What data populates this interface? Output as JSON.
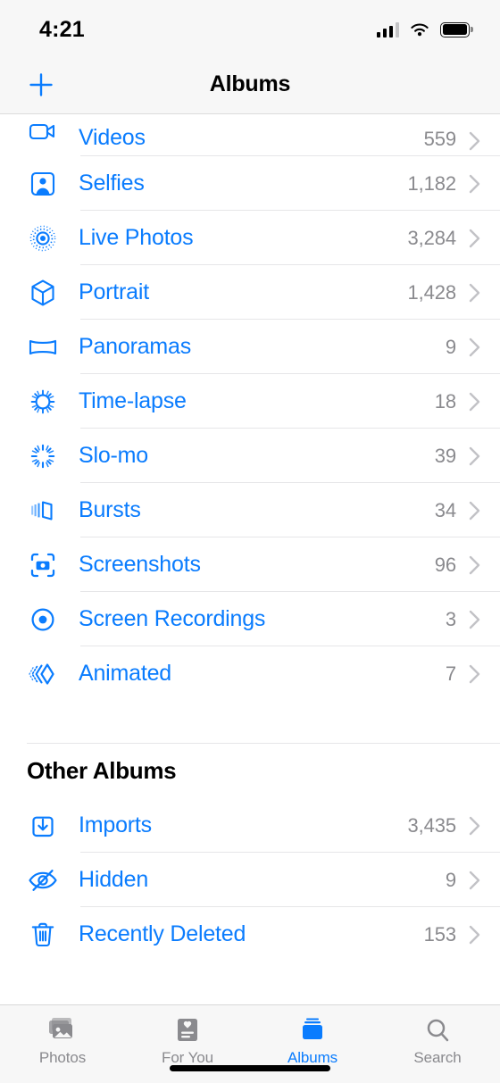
{
  "status_bar": {
    "time": "4:21",
    "icons": [
      "cellular-signal-icon",
      "wifi-icon",
      "battery-icon"
    ]
  },
  "nav_bar": {
    "add_label": "+",
    "add_icon": "plus-icon",
    "title": "Albums"
  },
  "colors": {
    "accent": "#0a7cfe",
    "count_text": "#8a8a8e",
    "chevron": "#c2c2c6",
    "separator": "#e6e6e8",
    "bar_background": "#f7f7f7"
  },
  "media_types_section": {
    "rows": [
      {
        "icon": "video-camera-icon",
        "label": "Videos",
        "count": "559",
        "clipped": true
      },
      {
        "icon": "selfie-portrait-icon",
        "label": "Selfies",
        "count": "1,182"
      },
      {
        "icon": "live-photo-icon",
        "label": "Live Photos",
        "count": "3,284"
      },
      {
        "icon": "portrait-cube-icon",
        "label": "Portrait",
        "count": "1,428"
      },
      {
        "icon": "panorama-icon",
        "label": "Panoramas",
        "count": "9"
      },
      {
        "icon": "time-lapse-icon",
        "label": "Time-lapse",
        "count": "18"
      },
      {
        "icon": "slo-mo-icon",
        "label": "Slo-mo",
        "count": "39"
      },
      {
        "icon": "bursts-stack-icon",
        "label": "Bursts",
        "count": "34"
      },
      {
        "icon": "screenshot-camera-icon",
        "label": "Screenshots",
        "count": "96"
      },
      {
        "icon": "screen-recording-icon",
        "label": "Screen Recordings",
        "count": "3"
      },
      {
        "icon": "animated-chevron-icon",
        "label": "Animated",
        "count": "7"
      }
    ]
  },
  "other_albums_section": {
    "header": "Other Albums",
    "rows": [
      {
        "icon": "import-tray-icon",
        "label": "Imports",
        "count": "3,435"
      },
      {
        "icon": "eye-slash-icon",
        "label": "Hidden",
        "count": "9"
      },
      {
        "icon": "trash-icon",
        "label": "Recently Deleted",
        "count": "153"
      }
    ]
  },
  "tab_bar": {
    "tabs": [
      {
        "icon": "photos-stack-icon",
        "label": "Photos",
        "active": false
      },
      {
        "icon": "for-you-card-icon",
        "label": "For You",
        "active": false
      },
      {
        "icon": "albums-book-icon",
        "label": "Albums",
        "active": true
      },
      {
        "icon": "magnifier-icon",
        "label": "Search",
        "active": false
      }
    ]
  }
}
